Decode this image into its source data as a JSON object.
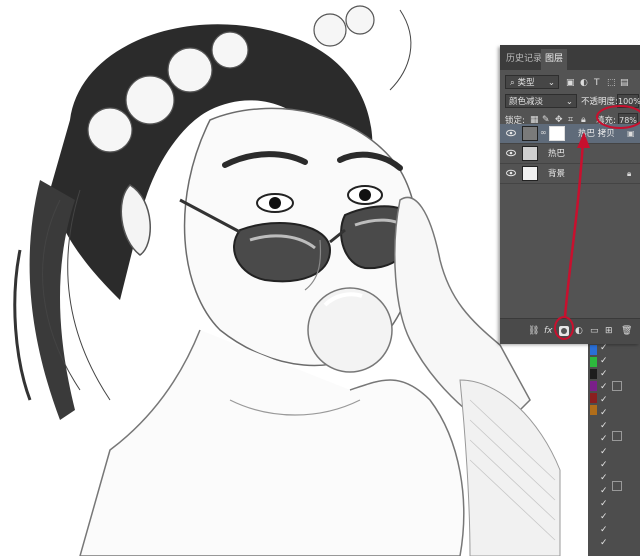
{
  "tabs": {
    "history": "历史记录",
    "layers": "图层"
  },
  "filter": {
    "kind": "类型"
  },
  "blend": {
    "mode": "颜色减淡",
    "opacity_label": "不透明度:",
    "opacity": "100%"
  },
  "lock": {
    "label": "锁定:",
    "fill_label": "填充:",
    "fill": "78%"
  },
  "layers": [
    {
      "name": "热巴 拷贝",
      "selected": true
    },
    {
      "name": "热巴",
      "selected": false
    },
    {
      "name": "背景",
      "selected": false
    }
  ],
  "bottom_icons": [
    "link-icon",
    "fx-icon",
    "mask-icon",
    "adjustment-icon",
    "group-icon",
    "new-layer-icon",
    "trash-icon"
  ],
  "colors": {
    "annotation_red": "#c8102e",
    "panel_bg": "#535353",
    "selected_layer": "#5f6b7a"
  },
  "strip_swatches": [
    "#2a6fd6",
    "#2db83d",
    "#1d1d1d",
    "#7a1f8a",
    "#8a1f1f",
    "#b06d1a"
  ]
}
